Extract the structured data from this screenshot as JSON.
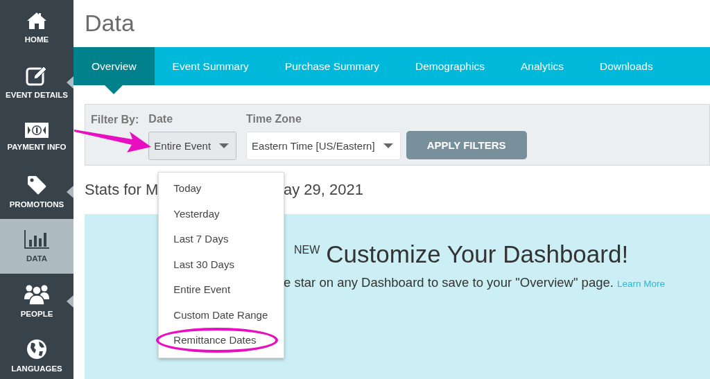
{
  "sidebar": {
    "items": [
      {
        "label": "HOME",
        "selected": false,
        "submenu": false
      },
      {
        "label": "EVENT DETAILS",
        "selected": false,
        "submenu": true
      },
      {
        "label": "PAYMENT INFO",
        "selected": false,
        "submenu": false
      },
      {
        "label": "PROMOTIONS",
        "selected": false,
        "submenu": true
      },
      {
        "label": "DATA",
        "selected": true,
        "submenu": false
      },
      {
        "label": "PEOPLE",
        "selected": false,
        "submenu": true
      },
      {
        "label": "LANGUAGES",
        "selected": false,
        "submenu": false
      }
    ]
  },
  "page_title": "Data",
  "tabs": [
    {
      "label": "Overview",
      "selected": true
    },
    {
      "label": "Event Summary",
      "selected": false
    },
    {
      "label": "Purchase Summary",
      "selected": false
    },
    {
      "label": "Demographics",
      "selected": false
    },
    {
      "label": "Analytics",
      "selected": false
    },
    {
      "label": "Downloads",
      "selected": false
    }
  ],
  "filters": {
    "label": "Filter By:",
    "pointer_arrow": true,
    "date": {
      "label": "Date",
      "value": "Entire Event",
      "open": true,
      "options": [
        {
          "label": "Today",
          "circled": false
        },
        {
          "label": "Yesterday",
          "circled": false
        },
        {
          "label": "Last 7 Days",
          "circled": false
        },
        {
          "label": "Last 30 Days",
          "circled": false
        },
        {
          "label": "Entire Event",
          "circled": false
        },
        {
          "label": "Custom Date Range",
          "circled": false
        },
        {
          "label": "Remittance Dates",
          "circled": true
        }
      ]
    },
    "time_zone": {
      "label": "Time Zone",
      "value": "Eastern Time [US/Eastern]"
    },
    "apply_button": "APPLY FILTERS"
  },
  "stats_heading": {
    "before_menu": "Stats for M",
    "after_menu": "ay 29, 2021"
  },
  "promo": {
    "badge": "NEW",
    "title": "Customize Your Dashboard!",
    "text": "e star on any Dashboard to save to your \"Overview\" page.",
    "link": "Learn More"
  }
}
